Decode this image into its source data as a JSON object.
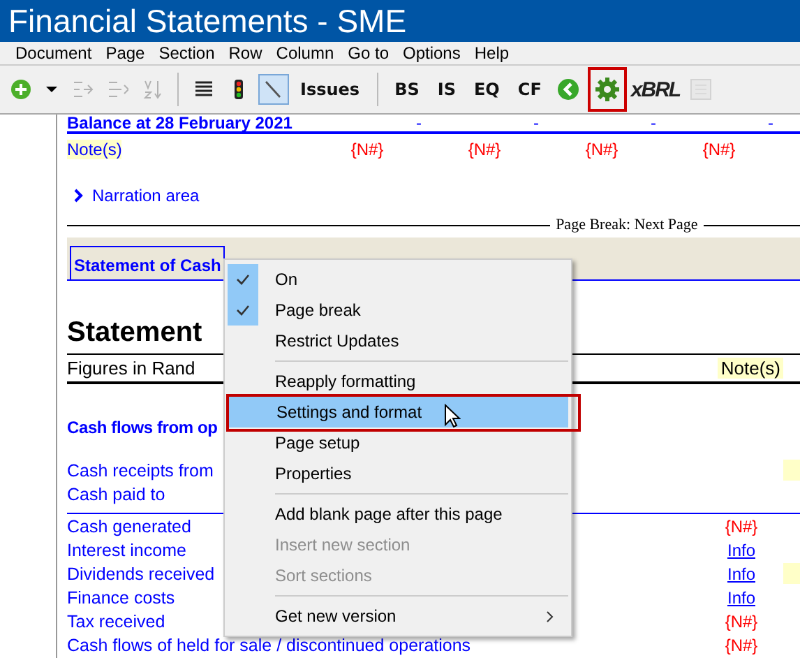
{
  "window": {
    "title": "Financial Statements - SME"
  },
  "menu_bar": [
    "Document",
    "Page",
    "Section",
    "Row",
    "Column",
    "Go to",
    "Options",
    "Help"
  ],
  "toolbar": [
    {
      "kind": "icon",
      "disabled": false,
      "pressed": false,
      "marked": false
    },
    {
      "kind": "icon",
      "disabled": false,
      "pressed": false,
      "marked": false
    },
    {
      "kind": "icon",
      "disabled": true,
      "pressed": false,
      "marked": false
    },
    {
      "kind": "icon",
      "disabled": true,
      "pressed": false,
      "marked": false
    },
    {
      "kind": "icon",
      "disabled": true,
      "pressed": false,
      "marked": false
    },
    {
      "kind": "separator"
    },
    {
      "kind": "icon",
      "disabled": false,
      "pressed": false,
      "marked": false
    },
    {
      "kind": "icon",
      "disabled": false,
      "pressed": false,
      "marked": false
    },
    {
      "kind": "icon",
      "disabled": false,
      "pressed": true,
      "marked": false
    },
    {
      "kind": "text",
      "label": "Issues"
    },
    {
      "kind": "separator"
    },
    {
      "kind": "text",
      "label": "BS"
    },
    {
      "kind": "text",
      "label": "IS"
    },
    {
      "kind": "text",
      "label": "EQ"
    },
    {
      "kind": "text",
      "label": "CF"
    },
    {
      "kind": "icon",
      "disabled": false,
      "pressed": false,
      "marked": false
    },
    {
      "kind": "icon",
      "disabled": false,
      "pressed": false,
      "marked": true
    },
    {
      "kind": "logo",
      "label": "xBRL"
    },
    {
      "kind": "icon",
      "disabled": true,
      "pressed": false,
      "marked": false
    }
  ],
  "balance_row": {
    "label": "Balance at 28 February 2021",
    "values": [
      "-",
      "-",
      "-",
      "-"
    ]
  },
  "notes_row": {
    "label": "Note(s)",
    "values": [
      "{N#}",
      "{N#}",
      "{N#}",
      "{N#}"
    ]
  },
  "narration": "Narration area",
  "page_break": "Page Break: Next Page",
  "section_title": "Statement of Cash",
  "heading": "Statement",
  "figures_row": {
    "label": "Figures in Rand",
    "note_header": "Note(s)"
  },
  "subheading": "Cash flows from op",
  "lines": [
    {
      "kind": "plain",
      "label": "Cash receipts from",
      "highlight": true,
      "rule_above": false
    },
    {
      "kind": "plain",
      "label": "Cash paid to",
      "highlight": false,
      "rule_above": false
    },
    {
      "kind": "reference",
      "label": "Cash generated",
      "note": "{N#}",
      "highlight": false,
      "rule_above": true
    },
    {
      "kind": "info",
      "label": "Interest income",
      "note": "Info",
      "highlight": false,
      "rule_above": false
    },
    {
      "kind": "info",
      "label": "Dividends received",
      "note": "Info",
      "highlight": true,
      "rule_above": false
    },
    {
      "kind": "info",
      "label": "Finance costs",
      "note": "Info",
      "highlight": false,
      "rule_above": false
    },
    {
      "kind": "reference",
      "label": "Tax received",
      "note": "{N#}",
      "highlight": false,
      "rule_above": false
    },
    {
      "kind": "reference",
      "label": "Cash flows of held for sale / discontinued operations",
      "note": "{N#}",
      "highlight": false,
      "rule_above": false
    }
  ],
  "context_menu": [
    {
      "kind": "item",
      "label": "On",
      "checked": true,
      "disabled": false,
      "selected": false,
      "marked": false,
      "submenu": false
    },
    {
      "kind": "item",
      "label": "Page break",
      "checked": true,
      "disabled": false,
      "selected": false,
      "marked": false,
      "submenu": false
    },
    {
      "kind": "item",
      "label": "Restrict Updates",
      "checked": false,
      "disabled": false,
      "selected": false,
      "marked": false,
      "submenu": false
    },
    {
      "kind": "separator"
    },
    {
      "kind": "item",
      "label": "Reapply formatting",
      "checked": false,
      "disabled": false,
      "selected": false,
      "marked": false,
      "submenu": false
    },
    {
      "kind": "item",
      "label": "Settings and format",
      "checked": false,
      "disabled": false,
      "selected": true,
      "marked": true,
      "submenu": false
    },
    {
      "kind": "item",
      "label": "Page setup",
      "checked": false,
      "disabled": false,
      "selected": false,
      "marked": false,
      "submenu": false
    },
    {
      "kind": "item",
      "label": "Properties",
      "checked": false,
      "disabled": false,
      "selected": false,
      "marked": false,
      "submenu": false
    },
    {
      "kind": "separator"
    },
    {
      "kind": "item",
      "label": "Add blank page after this page",
      "checked": false,
      "disabled": false,
      "selected": false,
      "marked": false,
      "submenu": false
    },
    {
      "kind": "item",
      "label": "Insert new section",
      "checked": false,
      "disabled": true,
      "selected": false,
      "marked": false,
      "submenu": false
    },
    {
      "kind": "item",
      "label": "Sort sections",
      "checked": false,
      "disabled": true,
      "selected": false,
      "marked": false,
      "submenu": false
    },
    {
      "kind": "separator"
    },
    {
      "kind": "item",
      "label": "Get new version",
      "checked": false,
      "disabled": false,
      "selected": false,
      "marked": false,
      "submenu": true
    }
  ]
}
